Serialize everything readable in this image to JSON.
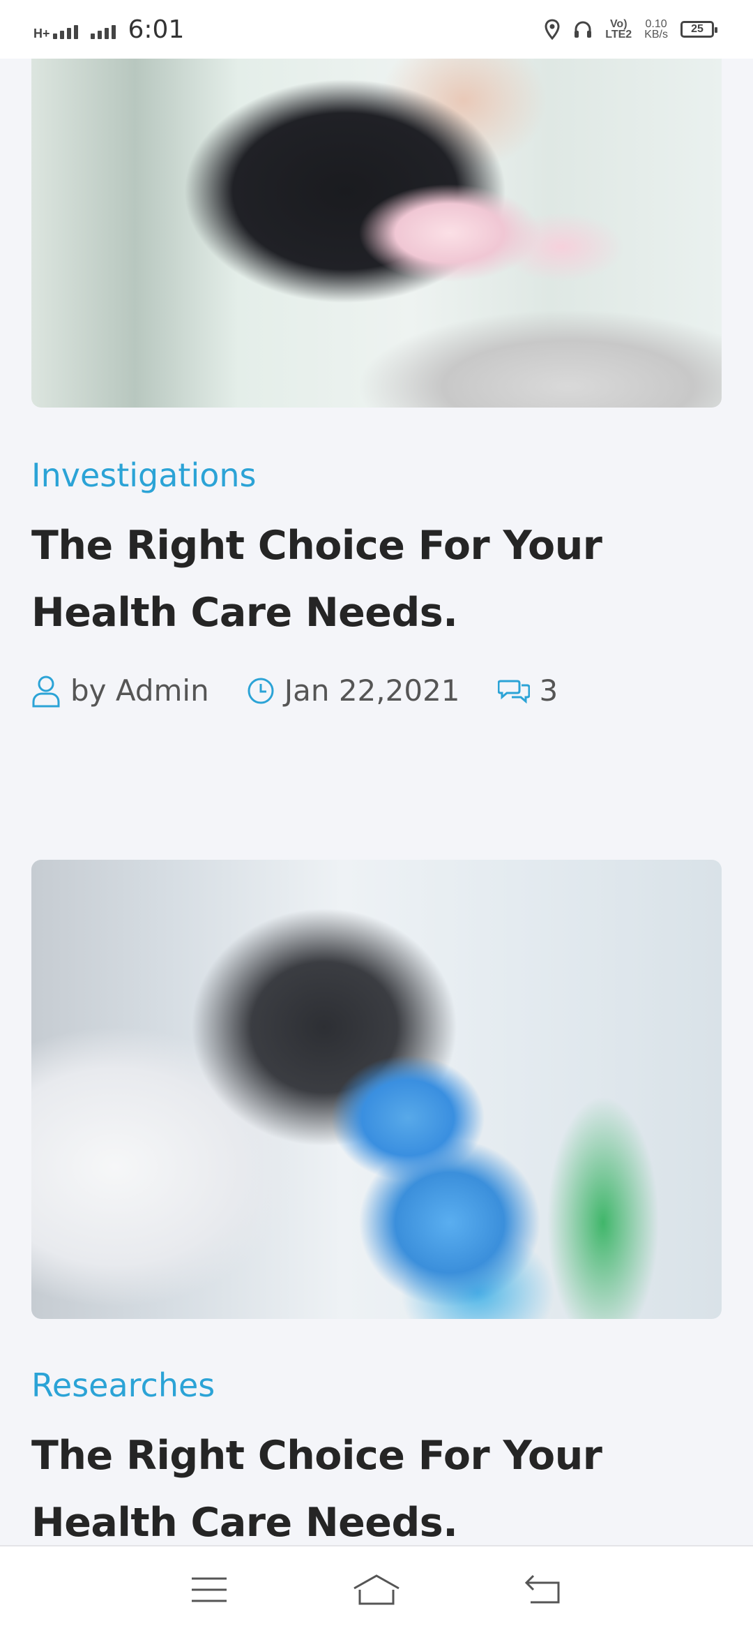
{
  "status_bar": {
    "network_type": "H+",
    "time": "6:01",
    "volte": "Vo)",
    "lte": "LTE2",
    "speed_value": "0.10",
    "speed_unit": "KB/s",
    "battery": "25"
  },
  "posts": [
    {
      "category": "Investigations",
      "title": "The Right Choice For Your Health Care Needs.",
      "author": "by Admin",
      "date": "Jan 22,2021",
      "comments": "3"
    },
    {
      "category": "Researches",
      "title": "The Right Choice For Your Health Care Needs."
    }
  ],
  "icons": {
    "author": "user-icon",
    "date": "clock-icon",
    "comments": "comments-icon",
    "nav_menu": "menu-icon",
    "nav_home": "home-icon",
    "nav_back": "back-icon"
  },
  "colors": {
    "accent": "#2ba3d6",
    "background": "#f4f5f9"
  }
}
